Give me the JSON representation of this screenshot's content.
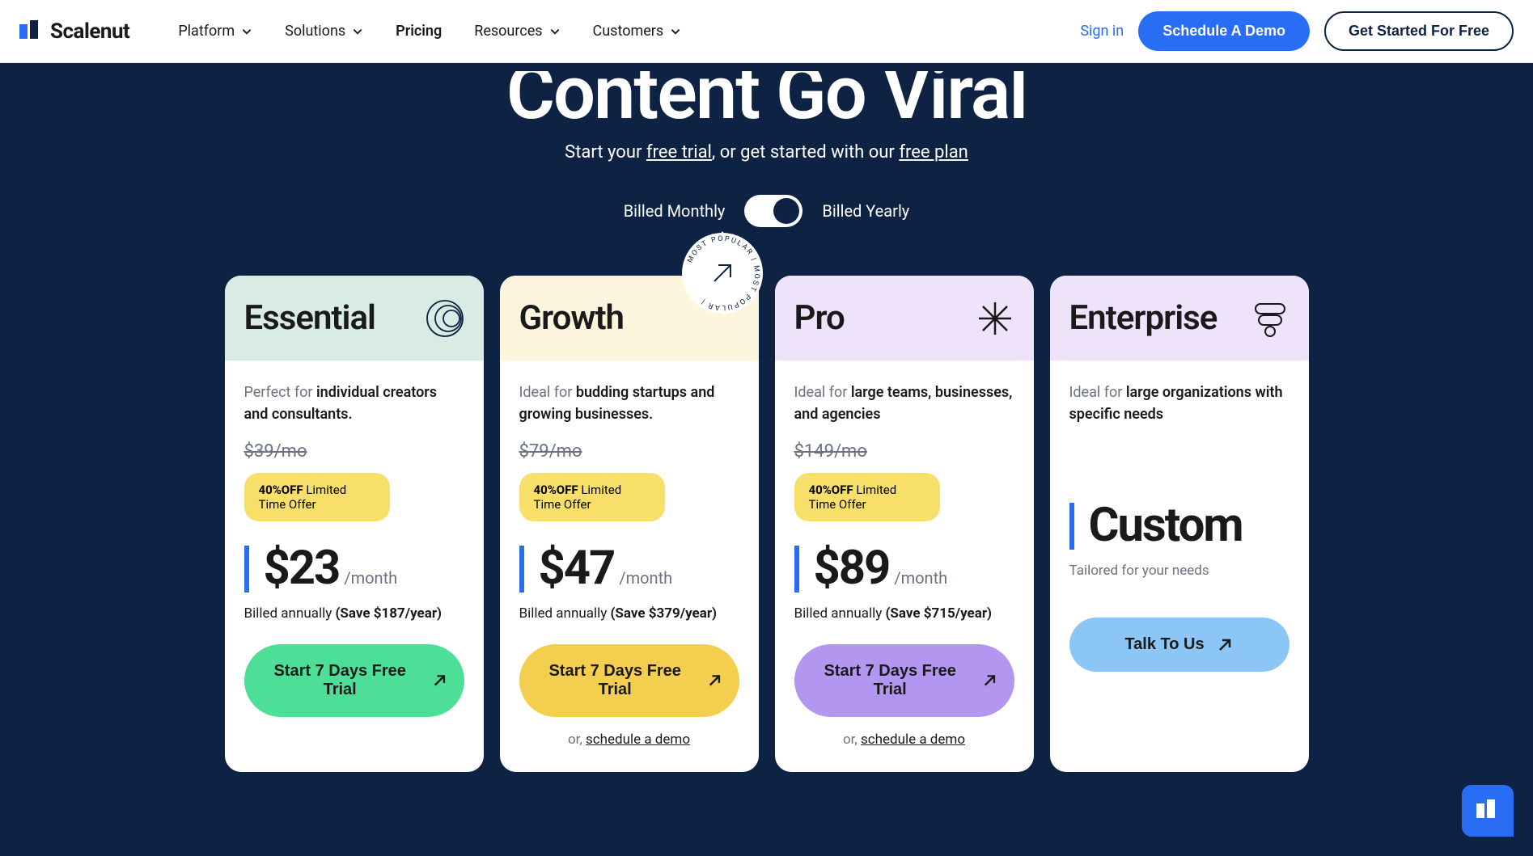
{
  "brand": "Scalenut",
  "nav": {
    "platform": "Platform",
    "solutions": "Solutions",
    "pricing": "Pricing",
    "resources": "Resources",
    "customers": "Customers"
  },
  "actions": {
    "signin": "Sign in",
    "demo": "Schedule A Demo",
    "free": "Get Started For Free"
  },
  "hero": {
    "title": "Content Go Viral",
    "sub_prefix": "Start your ",
    "free_trial": "free trial",
    "sub_mid": ", or get started with our ",
    "free_plan": "free plan"
  },
  "billing": {
    "monthly": "Billed Monthly",
    "yearly": "Billed Yearly"
  },
  "offer": {
    "pct": "40%OFF",
    "text": " Limited Time Offer"
  },
  "cta": {
    "trial": "Start 7 Days Free Trial",
    "talk": "Talk To Us",
    "or": "or, ",
    "schedule": "schedule a demo"
  },
  "plans": {
    "essential": {
      "name": "Essential",
      "tag_light": "Perfect for ",
      "tag_bold": "individual creators and consultants.",
      "old": "$39/mo",
      "price": "$23",
      "unit": "/month",
      "annually_prefix": "Billed annually ",
      "save": "(Save $187/year)"
    },
    "growth": {
      "name": "Growth",
      "badge": "MOST POPULAR",
      "tag_light": "Ideal for ",
      "tag_bold": "budding startups and growing businesses.",
      "old": "$79/mo",
      "price": "$47",
      "unit": "/month",
      "annually_prefix": "Billed annually ",
      "save": "(Save $379/year)"
    },
    "pro": {
      "name": "Pro",
      "tag_light": "Ideal for ",
      "tag_bold": "large teams, businesses, and agencies",
      "old": "$149/mo",
      "price": "$89",
      "unit": "/month",
      "annually_prefix": "Billed annually ",
      "save": "(Save $715/year)"
    },
    "enterprise": {
      "name": "Enterprise",
      "tag_light": "Ideal for ",
      "tag_bold": "large organizations with specific needs",
      "price": "Custom",
      "tailored": "Tailored for your needs"
    }
  }
}
